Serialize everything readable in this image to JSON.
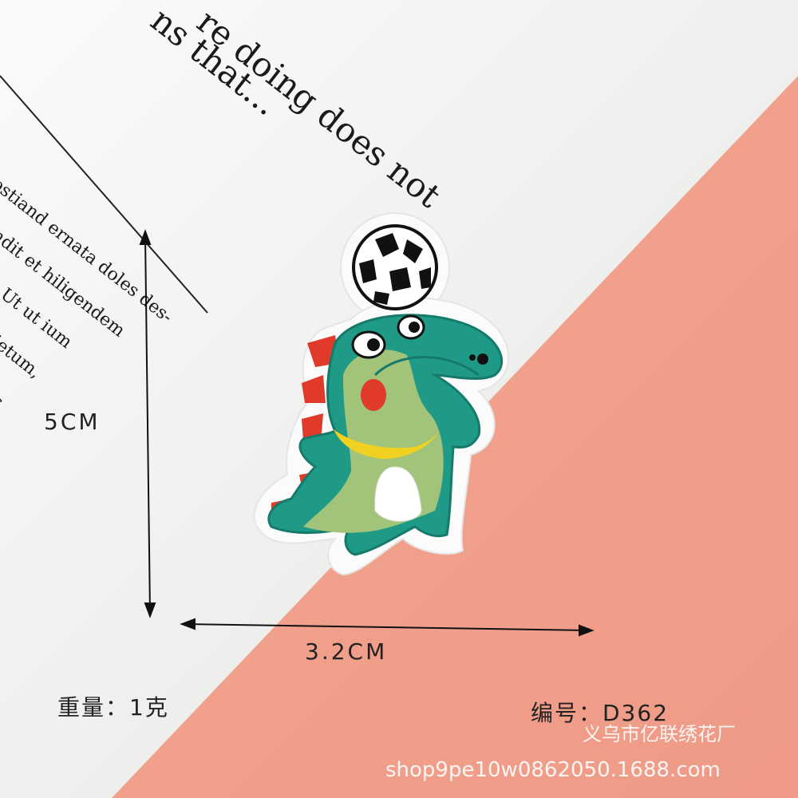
{
  "paper_text": {
    "line1": "re doing does not",
    "line2": "ns that...",
    "small1": "ostiand ernata doles des-",
    "small2": "ndit et hiligendem",
    "small3": ". Ut ut ium",
    "small4": "ietum,",
    "small5": "s"
  },
  "labels": {
    "height": "5CM",
    "width": "3.2CM",
    "weight": "重量：1克",
    "code": "编号：D362",
    "shop_name": "义乌市亿联绣花厂",
    "shop_url": "shop9pe10w0862050.1688.com"
  },
  "colors": {
    "pink": "#f2a591",
    "paper": "#f5f5f3",
    "patch_green": "#1f9a86",
    "patch_light": "#9fc27a",
    "patch_red": "#e03a2a",
    "patch_yellow": "#f0d020"
  }
}
